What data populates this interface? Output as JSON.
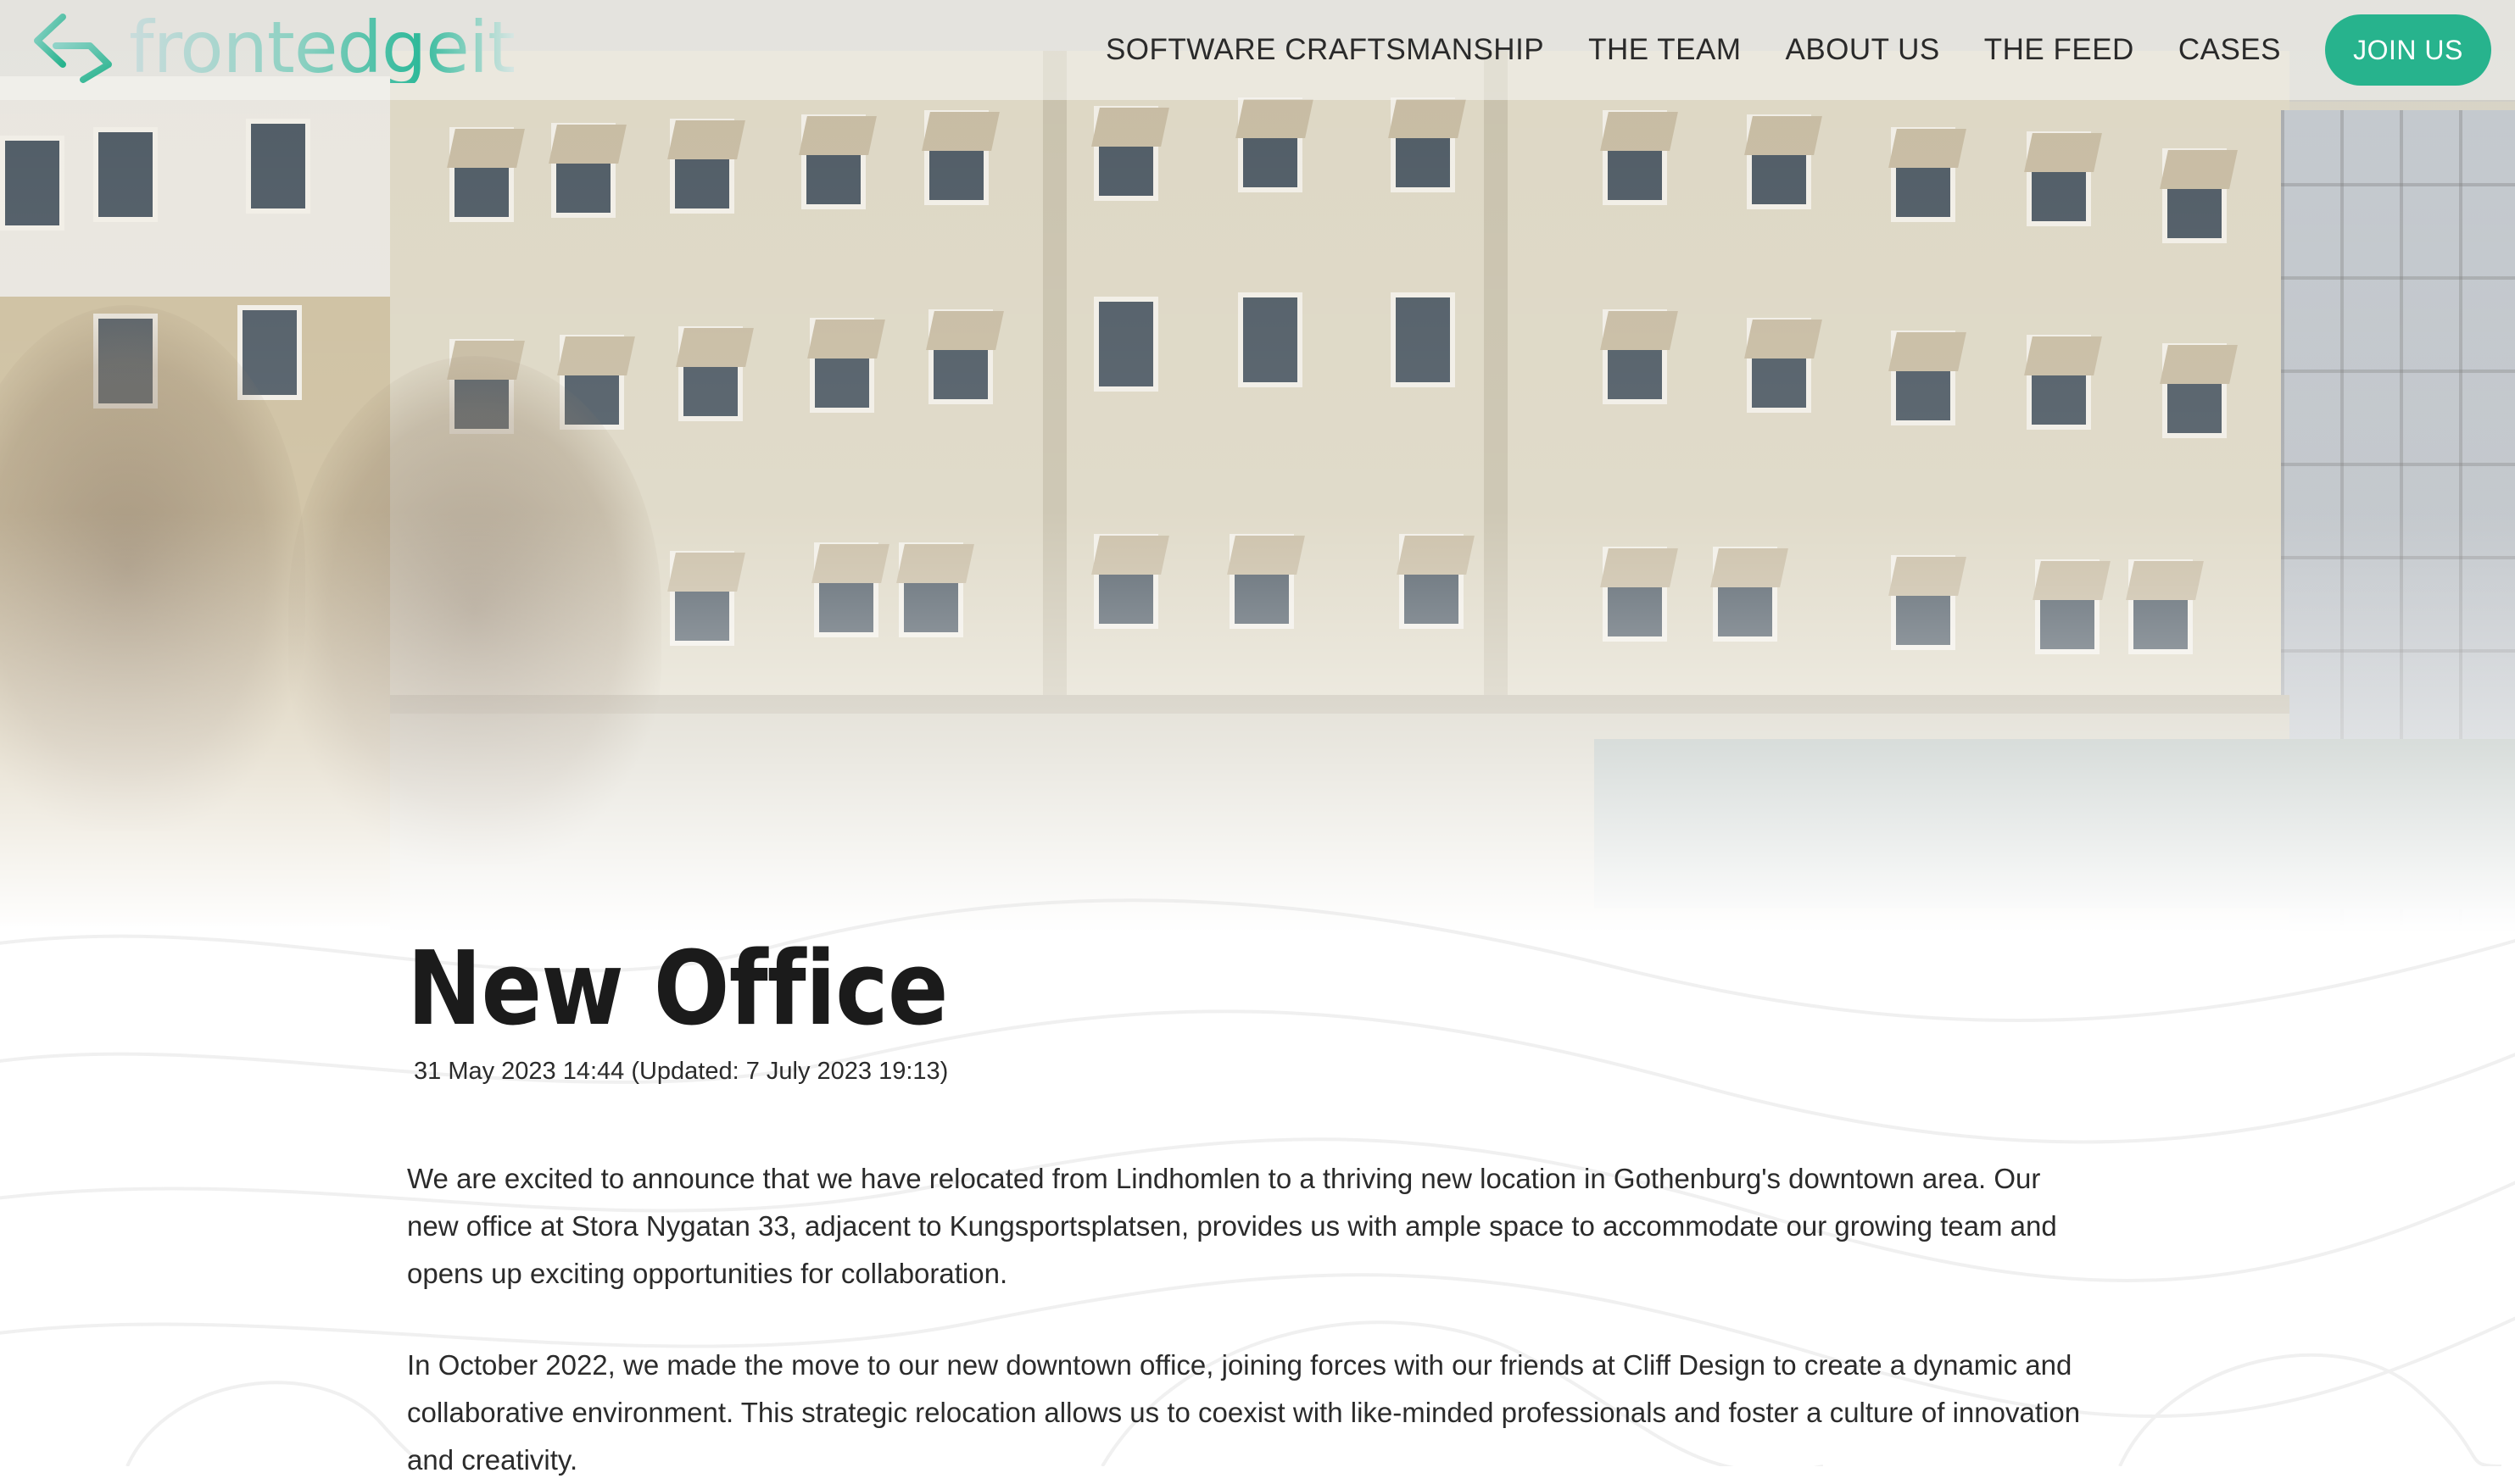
{
  "brand": {
    "name": "frontedgeit",
    "accent_color": "#27b38d",
    "logo_icon": "chevron-bracket-logo-icon"
  },
  "nav": {
    "items": [
      {
        "label": "SOFTWARE CRAFTSMANSHIP"
      },
      {
        "label": "THE TEAM"
      },
      {
        "label": "ABOUT US"
      },
      {
        "label": "THE FEED"
      },
      {
        "label": "CASES"
      }
    ],
    "cta_label": "JOIN US"
  },
  "article": {
    "title": "New Office",
    "published": "31 May 2023 14:44",
    "updated": "(Updated: 7 July 2023 19:13)",
    "paragraphs": [
      "We are excited to announce that we have relocated from Lindhomlen to a thriving new location in Gothenburg's downtown area. Our new office at Stora Nygatan 33, adjacent to Kungsportsplatsen, provides us with ample space to accommodate our growing team and opens up exciting opportunities for collaboration.",
      "In October 2022, we made the move to our new downtown office, joining forces with our friends at Cliff Design to create a dynamic and collaborative environment. This strategic relocation allows us to coexist with like-minded professionals and foster a culture of innovation and creativity."
    ]
  },
  "hero": {
    "image": "office-building-photo"
  }
}
